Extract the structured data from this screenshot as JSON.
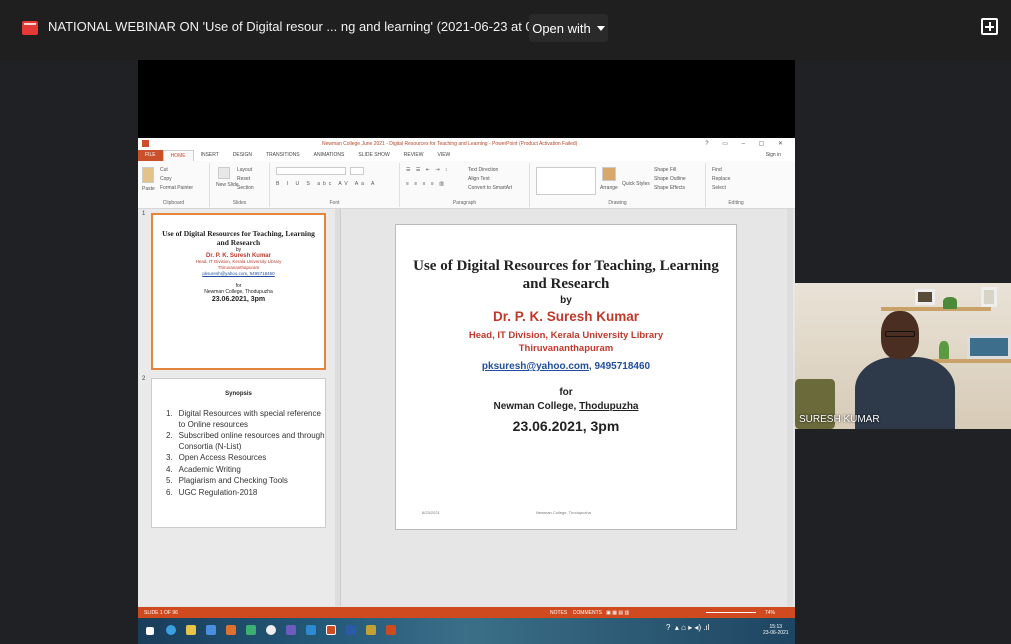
{
  "viewer": {
    "title": "NATIONAL WEBINAR ON 'Use of Digital resour ... ng and learning' (2021-06-23 at 02:31 GMT-7)",
    "open_with": "Open with"
  },
  "ppt": {
    "window_title": "Newman College June 2021 - Digital Resources for Teaching and Learning - PowerPoint (Product Activation Failed)",
    "sign_in": "Sign in",
    "tabs": [
      "FILE",
      "HOME",
      "INSERT",
      "DESIGN",
      "TRANSITIONS",
      "ANIMATIONS",
      "SLIDE SHOW",
      "REVIEW",
      "VIEW"
    ],
    "groups": {
      "clipboard": "Clipboard",
      "slides": "Slides",
      "font": "Font",
      "paragraph": "Paragraph",
      "drawing": "Drawing",
      "editing": "Editing"
    },
    "ribbon_items": {
      "paste": "Paste",
      "cut": "Cut",
      "copy": "Copy",
      "format_painter": "Format Painter",
      "new_slide": "New Slide",
      "layout": "Layout",
      "reset": "Reset",
      "section": "Section",
      "text_direction": "Text Direction",
      "align_text": "Align Text",
      "convert_smartart": "Convert to SmartArt",
      "arrange": "Arrange",
      "quick_styles": "Quick Styles",
      "shape_fill": "Shape Fill",
      "shape_outline": "Shape Outline",
      "shape_effects": "Shape Effects",
      "find": "Find",
      "replace": "Replace",
      "select": "Select"
    },
    "thumb1": {
      "num": "1",
      "title": "Use of Digital Resources for Teaching, Learning and Research",
      "by": "by",
      "author": "Dr. P. K. Suresh Kumar",
      "aff1": "Head, IT Division, Kerala University Library",
      "aff2": "Thiruvananthapuram",
      "email": "pksuresh@yahoo.com, 9495718460",
      "for": "for",
      "college": "Newman College, Thodupuzha",
      "date": "23.06.2021, 3pm"
    },
    "thumb2": {
      "num": "2",
      "heading": "Synopsis",
      "items": [
        {
          "n": "1.",
          "t": "Digital Resources with special reference to Online resources"
        },
        {
          "n": "2.",
          "t": "Subscribed online resources and through Consortia (N-List)"
        },
        {
          "n": "3.",
          "t": "Open Access Resources"
        },
        {
          "n": "4.",
          "t": "Academic Writing"
        },
        {
          "n": "5.",
          "t": "Plagiarism and Checking Tools"
        },
        {
          "n": "6.",
          "t": "UGC Regulation-2018"
        }
      ]
    },
    "slide": {
      "title_line1": "Use of Digital Resources for  Teaching, Learning",
      "title_line2": "and Research",
      "by": "by",
      "author": "Dr. P. K. Suresh Kumar",
      "aff1": "Head, IT Division, Kerala University Library",
      "aff2": "Thiruvananthapuram",
      "email": "pksuresh@yahoo.com",
      "phone": ", 9495718460",
      "for": "for",
      "college_a": "Newman College, ",
      "college_b": "Thodupuzha",
      "date": "23.06.2021, 3pm",
      "footer_left": "6/23/2021",
      "footer_mid": "Newman College, Thodupuzha"
    },
    "status": {
      "slide_of": "SLIDE 1 OF 96",
      "notes": "NOTES",
      "comments": "COMMENTS",
      "zoom": "74%"
    },
    "taskbar": {
      "time": "15:13",
      "date": "23-06-2021"
    }
  },
  "webcam": {
    "name": "SURESH KUMAR"
  },
  "colors": {
    "accent": "#d04a1f",
    "author_red": "#c0392b",
    "link_blue": "#1f4e9e"
  }
}
